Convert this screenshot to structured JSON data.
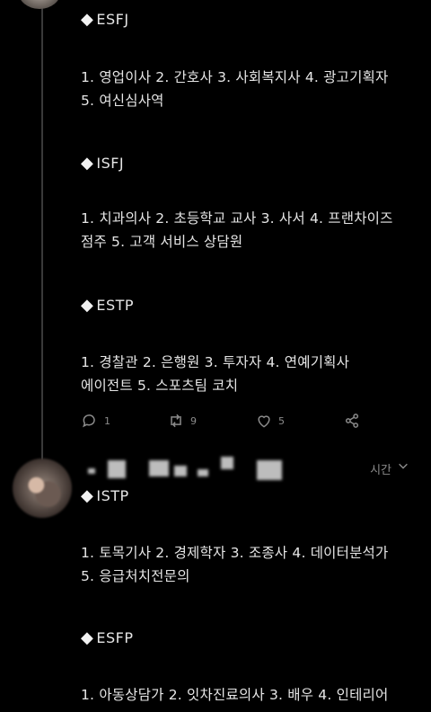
{
  "tweet1": {
    "sections": [
      {
        "heading": "ESFJ",
        "lines": [
          "1. 영업이사 2. 간호사 3. 사회복지사 4. 광고기획자",
          "5. 여신심사역"
        ]
      },
      {
        "heading": "ISFJ",
        "lines": [
          "1. 치과의사 2. 초등학교 교사 3. 사서 4. 프랜차이즈",
          "점주 5. 고객 서비스 상담원"
        ]
      },
      {
        "heading": "ESTP",
        "lines": [
          "1. 경찰관 2. 은행원 3. 투자자 4. 연예기획사",
          "에이전트 5. 스포츠팀 코치"
        ]
      }
    ],
    "actions": {
      "reply_icon": "comment-icon",
      "reply_count": "1",
      "retweet_icon": "retweet-icon",
      "retweet_count": "9",
      "like_icon": "heart-icon",
      "like_count": "5",
      "share_icon": "share-icon"
    }
  },
  "tweet2": {
    "author_name_blurred": true,
    "time_label": "시간",
    "sections": [
      {
        "heading": "ISTP",
        "lines": [
          "1. 토목기사 2. 경제학자 3. 조종사 4. 데이터분석가",
          "5. 응급처치전문의"
        ]
      },
      {
        "heading": "ESFP",
        "lines": [
          "1. 아동상담가 2. 잇차진료의사 3. 배우 4. 인테리어"
        ]
      }
    ]
  },
  "colors": {
    "background": "#000000",
    "text": "#e6e6e6",
    "muted": "#8b8b8b"
  }
}
